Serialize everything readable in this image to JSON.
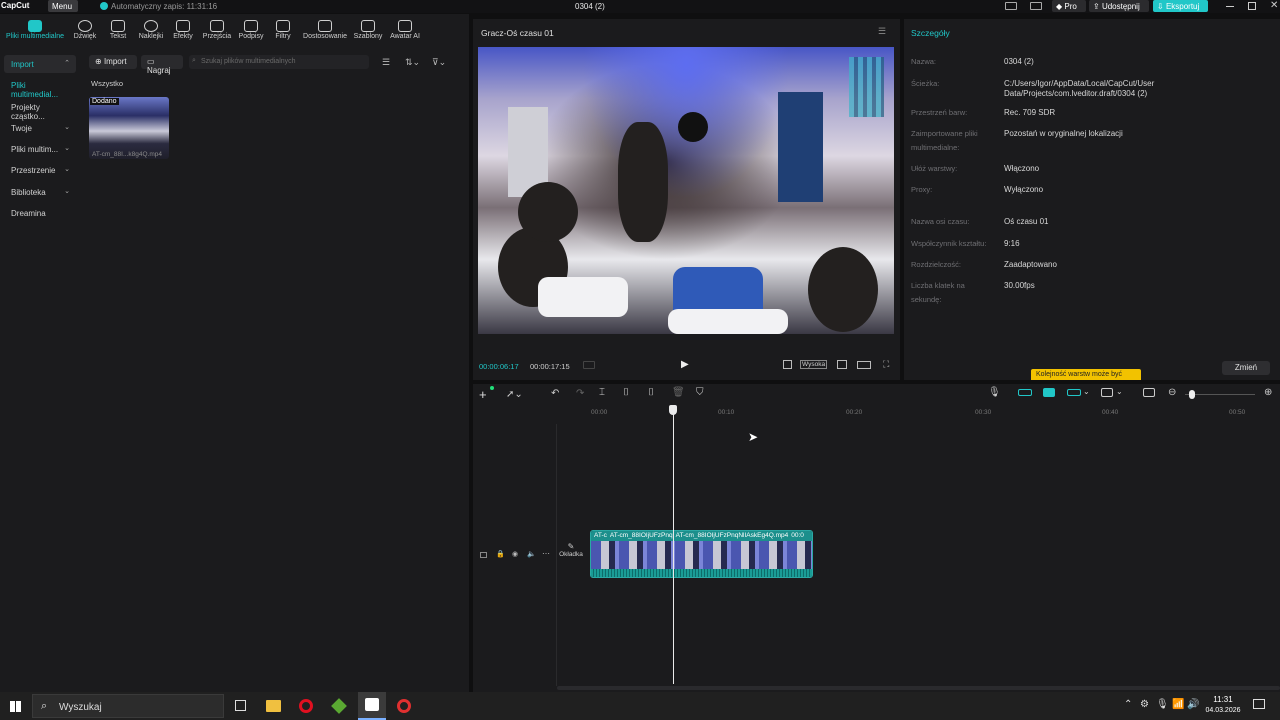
{
  "titlebar": {
    "app_logo": "CapCut",
    "menu_label": "Menu",
    "autosave": "Automatyczny zapis: 11:31:16",
    "project_title": "0304 (2)",
    "pro_label": "Pro",
    "share_label": "Udostępnij",
    "export_label": "Eksportuj"
  },
  "toolbar": {
    "items": [
      {
        "label": "Pliki multimedialne",
        "icon": "media-icon"
      },
      {
        "label": "Dźwięk",
        "icon": "audio-icon"
      },
      {
        "label": "Tekst",
        "icon": "text-icon"
      },
      {
        "label": "Naklejki",
        "icon": "sticker-icon"
      },
      {
        "label": "Efekty",
        "icon": "effects-icon"
      },
      {
        "label": "Przejścia",
        "icon": "transitions-icon"
      },
      {
        "label": "Podpisy",
        "icon": "captions-icon"
      },
      {
        "label": "Filtry",
        "icon": "filters-icon"
      },
      {
        "label": "Dostosowanie",
        "icon": "adjust-icon"
      },
      {
        "label": "Szablony",
        "icon": "templates-icon"
      },
      {
        "label": "Awatar AI",
        "icon": "avatar-icon"
      }
    ]
  },
  "sidenav": {
    "items": [
      {
        "label": "Import"
      },
      {
        "label": "Pliki multimedial..."
      },
      {
        "label": "Projekty cząstko..."
      },
      {
        "label": "Twoje"
      },
      {
        "label": "Pliki multim..."
      },
      {
        "label": "Przestrzenie"
      },
      {
        "label": "Biblioteka"
      },
      {
        "label": "Dreamina"
      }
    ]
  },
  "media": {
    "import_label": "Import",
    "record_label": "Nagraj",
    "search_placeholder": "Szukaj plików multimedialnych",
    "filter_all": "Wszystko",
    "thumb_badge": "Dodano",
    "thumb_name": "AT-cm_88I...k8g4Q.mp4"
  },
  "player": {
    "title": "Gracz-Oś czasu 01",
    "current_time": "00:00:06:17",
    "total_time": "00:00:17:15",
    "quality": "Wysoka",
    "ratio": "Stosunek"
  },
  "details": {
    "header": "Szczegóły",
    "rows1": [
      {
        "label": "Nazwa:",
        "value": "0304 (2)"
      },
      {
        "label": "Ścieżka:",
        "value": "C:/Users/Igor/AppData/Local/CapCut/User Data/Projects/com.lveditor.draft/0304 (2)"
      },
      {
        "label": "Przestrzeń barw:",
        "value": "Rec. 709 SDR"
      },
      {
        "label": "Zaimportowane pliki multimedialne:",
        "value": "Pozostań w oryginalnej lokalizacji"
      },
      {
        "label": "Ułóż warstwy:",
        "value": "Włączono"
      },
      {
        "label": "Proxy:",
        "value": "Wyłączono"
      }
    ],
    "rows2": [
      {
        "label": "Nazwa osi czasu:",
        "value": "Oś czasu 01"
      },
      {
        "label": "Współczynnik kształtu:",
        "value": "9:16"
      },
      {
        "label": "Rozdzielczość:",
        "value": "Zaadaptowano"
      },
      {
        "label": "Liczba klatek na sekundę:",
        "value": "30.00fps"
      }
    ],
    "tooltip": "Kolejność warstw może być",
    "change_label": "Zmień"
  },
  "timeline": {
    "ruler": [
      "00:00",
      "00:10",
      "00:20",
      "00:30",
      "00:40",
      "00:50"
    ],
    "cover_label": "Okładka",
    "clip_label": "AT-cm_88IOIjUFzPnqNlIAskEg4Q.mp4",
    "clip_short": "AT-c",
    "clip_mid": "AT-cm_88IOIjUFzPnq",
    "clip_end": "00:0"
  },
  "taskbar": {
    "search_placeholder": "Wyszukaj",
    "time": "11:31",
    "date": "04.03.2026"
  },
  "colors": {
    "accent": "#21c7c8",
    "export_btn": "#21c7c8",
    "tooltip": "#f2c200"
  }
}
